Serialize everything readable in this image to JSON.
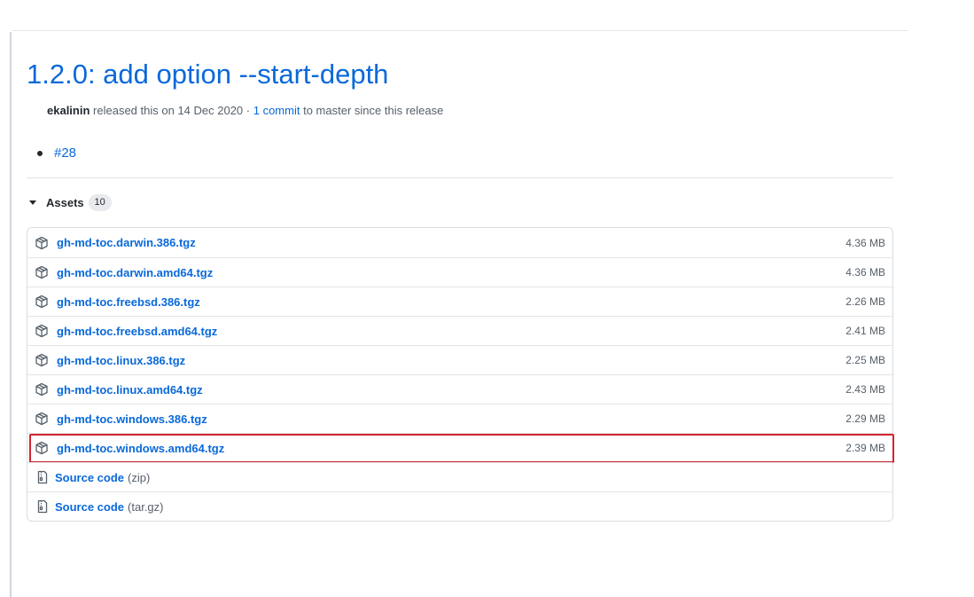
{
  "release": {
    "title": "1.2.0: add option --start-depth",
    "author": "ekalinin",
    "released_text": "released this on 14 Dec 2020 ·",
    "commit_link": "1 commit",
    "commit_suffix": "to master since this release",
    "notes": [
      {
        "text": "#28"
      }
    ]
  },
  "assets": {
    "label": "Assets",
    "count": "10",
    "items": [
      {
        "name": "gh-md-toc.darwin.386.tgz",
        "size": "4.36 MB",
        "icon": "package-icon"
      },
      {
        "name": "gh-md-toc.darwin.amd64.tgz",
        "size": "4.36 MB",
        "icon": "package-icon"
      },
      {
        "name": "gh-md-toc.freebsd.386.tgz",
        "size": "2.26 MB",
        "icon": "package-icon"
      },
      {
        "name": "gh-md-toc.freebsd.amd64.tgz",
        "size": "2.41 MB",
        "icon": "package-icon"
      },
      {
        "name": "gh-md-toc.linux.386.tgz",
        "size": "2.25 MB",
        "icon": "package-icon"
      },
      {
        "name": "gh-md-toc.linux.amd64.tgz",
        "size": "2.43 MB",
        "icon": "package-icon"
      },
      {
        "name": "gh-md-toc.windows.386.tgz",
        "size": "2.29 MB",
        "icon": "package-icon"
      },
      {
        "name": "gh-md-toc.windows.amd64.tgz",
        "size": "2.39 MB",
        "icon": "package-icon",
        "highlighted": true
      }
    ],
    "source": [
      {
        "name": "Source code",
        "suffix": "(zip)",
        "icon": "file-zip-icon"
      },
      {
        "name": "Source code",
        "suffix": "(tar.gz)",
        "icon": "file-zip-icon"
      }
    ]
  },
  "colors": {
    "link": "#0969da",
    "highlight_border": "#d1242f"
  }
}
